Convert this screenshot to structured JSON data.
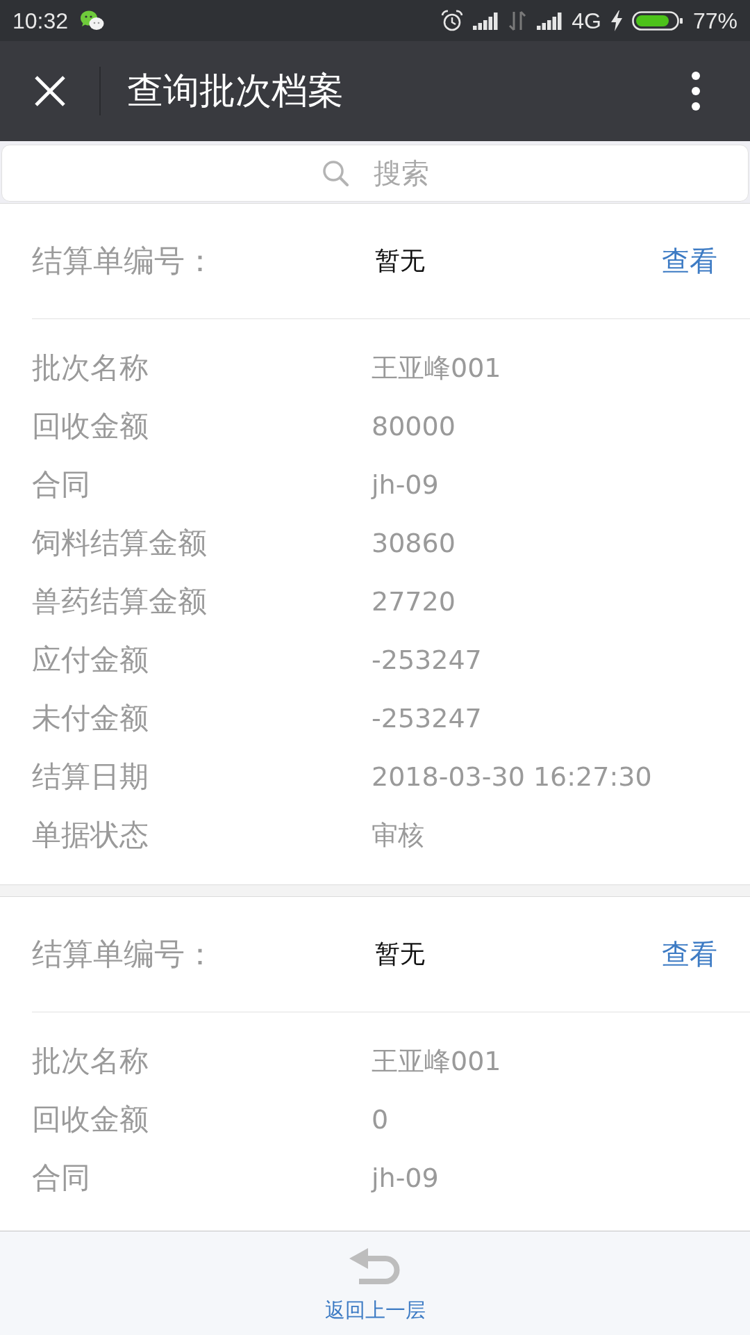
{
  "status_bar": {
    "time": "10:32",
    "network": "4G",
    "battery": "77%"
  },
  "title_bar": {
    "title": "查询批次档案"
  },
  "search": {
    "placeholder": "搜索"
  },
  "records": [
    {
      "number_label": "结算单编号：",
      "number": "暂无",
      "action": "查看",
      "fields": [
        {
          "label": "批次名称",
          "value": "王亚峰001"
        },
        {
          "label": "回收金额",
          "value": "80000"
        },
        {
          "label": "合同",
          "value": "jh-09"
        },
        {
          "label": "饲料结算金额",
          "value": "30860"
        },
        {
          "label": "兽药结算金额",
          "value": "27720"
        },
        {
          "label": "应付金额",
          "value": "-253247"
        },
        {
          "label": "未付金额",
          "value": "-253247"
        },
        {
          "label": "结算日期",
          "value": "2018-03-30 16:27:30"
        },
        {
          "label": "单据状态",
          "value": "审核"
        }
      ]
    },
    {
      "number_label": "结算单编号：",
      "number": "暂无",
      "action": "查看",
      "fields": [
        {
          "label": "批次名称",
          "value": "王亚峰001"
        },
        {
          "label": "回收金额",
          "value": "0"
        },
        {
          "label": "合同",
          "value": "jh-09"
        }
      ]
    }
  ],
  "footer": {
    "back": "返回上一层"
  }
}
